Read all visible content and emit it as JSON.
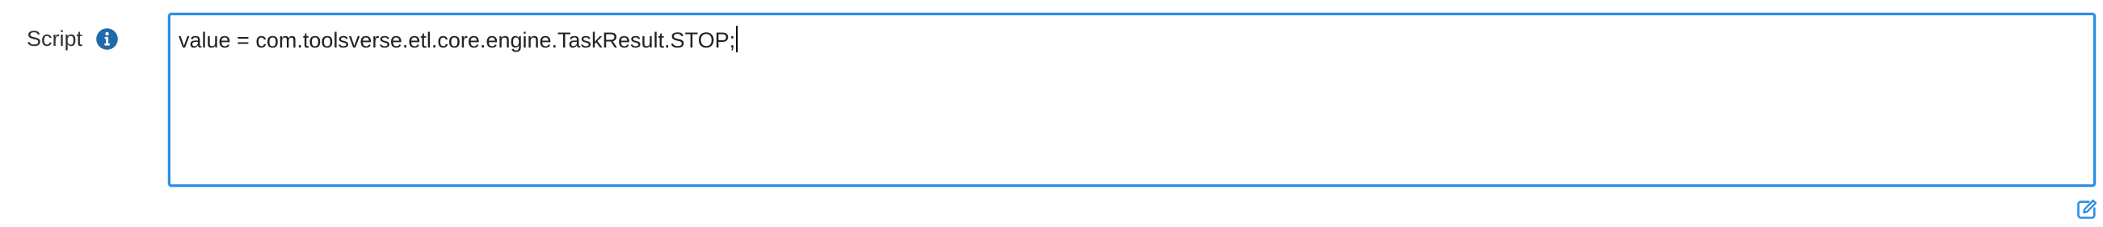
{
  "field": {
    "label": "Script",
    "value": "value = com.toolsverse.etl.core.engine.TaskResult.STOP;"
  },
  "icons": {
    "info": "info-circle-icon",
    "edit": "edit-pencil-icon"
  },
  "colors": {
    "accent": "#2b8ee3",
    "info_icon": "#1f6aa8",
    "label": "#333333"
  }
}
